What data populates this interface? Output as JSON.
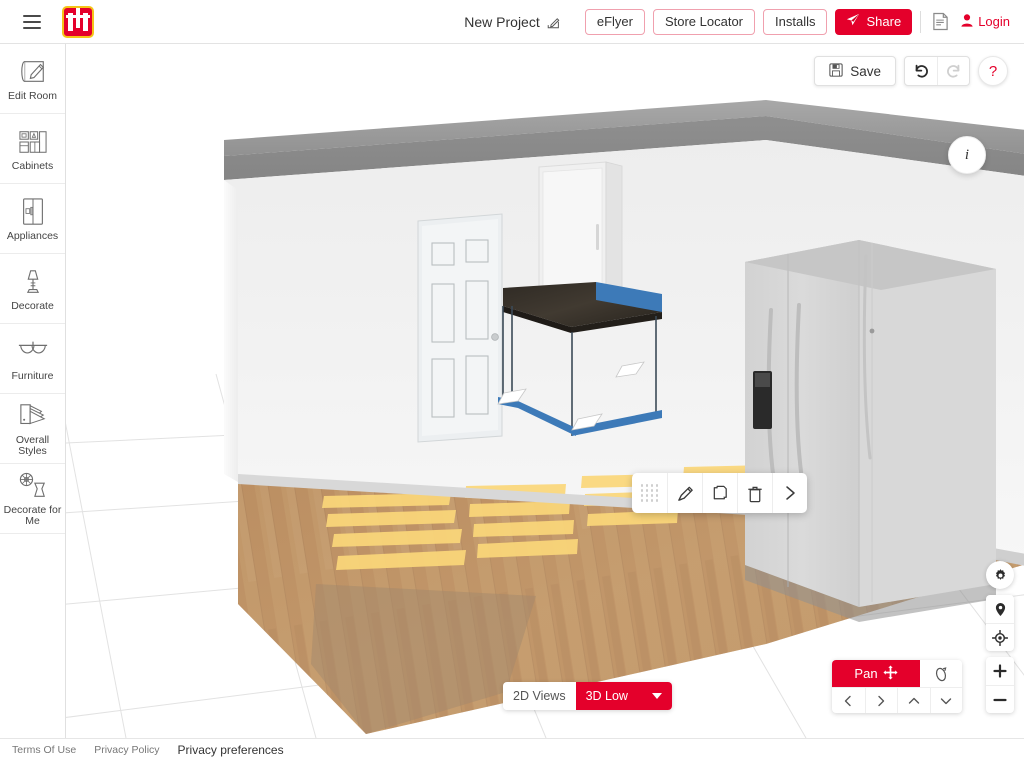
{
  "header": {
    "menu_icon": "hamburger-menu-icon",
    "logo_alt": "home-hardware-logo",
    "project_title": "New Project",
    "edit_icon": "edit-pencil-icon",
    "buttons": [
      {
        "label": "eFlyer",
        "name": "eflyer-button"
      },
      {
        "label": "Store Locator",
        "name": "store-locator-button"
      },
      {
        "label": "Installs",
        "name": "installs-button"
      }
    ],
    "share_label": "Share",
    "share_icon": "paper-plane-icon",
    "print_icon": "document-print-icon",
    "login_label": "Login",
    "login_icon": "user-icon"
  },
  "sidebar": {
    "items": [
      {
        "label": "Edit Room",
        "icon": "blueprint-pencil-icon"
      },
      {
        "label": "Cabinets",
        "icon": "cabinets-icon"
      },
      {
        "label": "Appliances",
        "icon": "appliance-fridge-icon"
      },
      {
        "label": "Decorate",
        "icon": "lamp-icon"
      },
      {
        "label": "Furniture",
        "icon": "table-icon"
      },
      {
        "label": "Overall Styles",
        "icon": "color-swatch-fan-icon"
      },
      {
        "label": "Decorate for Me",
        "icon": "flower-vase-icon"
      }
    ]
  },
  "toolbar": {
    "save_label": "Save",
    "save_icon": "floppy-disk-icon",
    "undo_icon": "undo-arrow-icon",
    "redo_icon": "redo-arrow-icon",
    "help_label": "?",
    "info_label": "i"
  },
  "object_toolbar": {
    "drag_handle_icon": "drag-dots-icon",
    "edit_icon": "pencil-edit-icon",
    "duplicate_icon": "copy-duplicate-icon",
    "delete_icon": "trash-delete-icon",
    "more_icon": "chevron-right-icon"
  },
  "view_mode": {
    "views_2d_label": "2D Views",
    "quality_label": "3D Low",
    "dropdown_icon": "chevron-down-icon"
  },
  "nav_controls": {
    "pan_label": "Pan",
    "pan_icon": "move-arrows-icon",
    "orbit_icon": "orbit-rotate-icon",
    "left_icon": "chevron-left-icon",
    "right_icon": "chevron-right-icon",
    "up_icon": "chevron-up-icon",
    "down_icon": "chevron-down-icon",
    "gear_icon": "settings-gear-icon",
    "pin_icon": "location-pin-icon",
    "center_icon": "recenter-target-icon",
    "zoom_in_label": "+",
    "zoom_out_label": "−"
  },
  "footer": {
    "terms_label": "Terms Of Use",
    "privacy_label": "Privacy Policy",
    "preferences_label": "Privacy preferences"
  },
  "colors": {
    "brand_red": "#e4002b",
    "logo_yellow": "#f5c518",
    "selection_blue": "#3d7ab8",
    "floor_wood": "#c49a6c",
    "wall_white": "#f2f2f2",
    "ceiling_gray": "#8d8d8d",
    "counter_dark": "#2e2822",
    "sunlight_yellow": "#fbd77a"
  }
}
